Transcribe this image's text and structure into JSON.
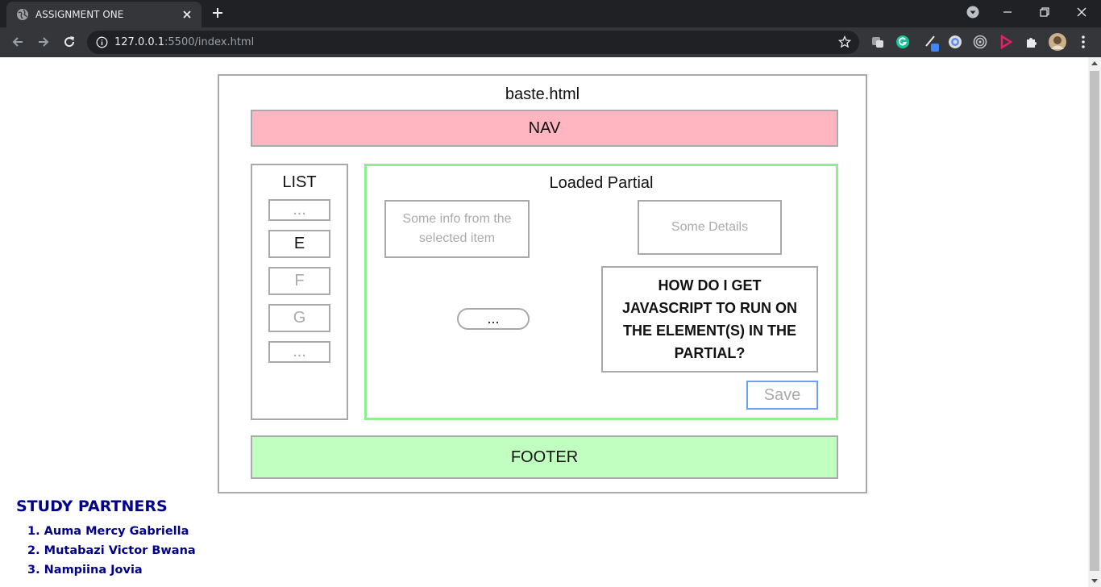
{
  "browser": {
    "tab_title": "ASSIGNMENT ONE",
    "url_host": "127.0.0.1",
    "url_rest": ":5500/index.html",
    "icons": [
      "globe-icon",
      "close-icon",
      "plus-icon",
      "profile-dropdown-icon",
      "minimize-icon",
      "restore-icon",
      "close-window-icon",
      "back-icon",
      "forward-icon",
      "reload-icon",
      "info-icon",
      "star-icon",
      "extension-icons",
      "puzzle-icon",
      "avatar",
      "menu-icon"
    ]
  },
  "diagram": {
    "title": "baste.html",
    "nav_label": "NAV",
    "list": {
      "title": "LIST",
      "items": [
        "...",
        "E",
        "F",
        "G",
        "..."
      ]
    },
    "partial": {
      "title": "Loaded Partial",
      "info_text": "Some info from the selected item",
      "details_text": "Some Details",
      "question": "HOW DO I GET JAVASCRIPT TO RUN ON THE ELEMENT(S) IN THE PARTIAL?",
      "pill_label": "...",
      "save_label": "Save"
    },
    "footer_label": "FOOTER"
  },
  "partners": {
    "heading": "STUDY PARTNERS",
    "names": [
      "1. Auma Mercy Gabriella",
      "2. Mutabazi Victor Bwana",
      "3. Nampiina Jovia"
    ]
  },
  "colors": {
    "nav_bg": "#ffb6c1",
    "footer_bg": "#c1ffc1",
    "partial_border": "#90ee90",
    "save_border": "#6f9ef3",
    "partners_text": "#00008b"
  }
}
